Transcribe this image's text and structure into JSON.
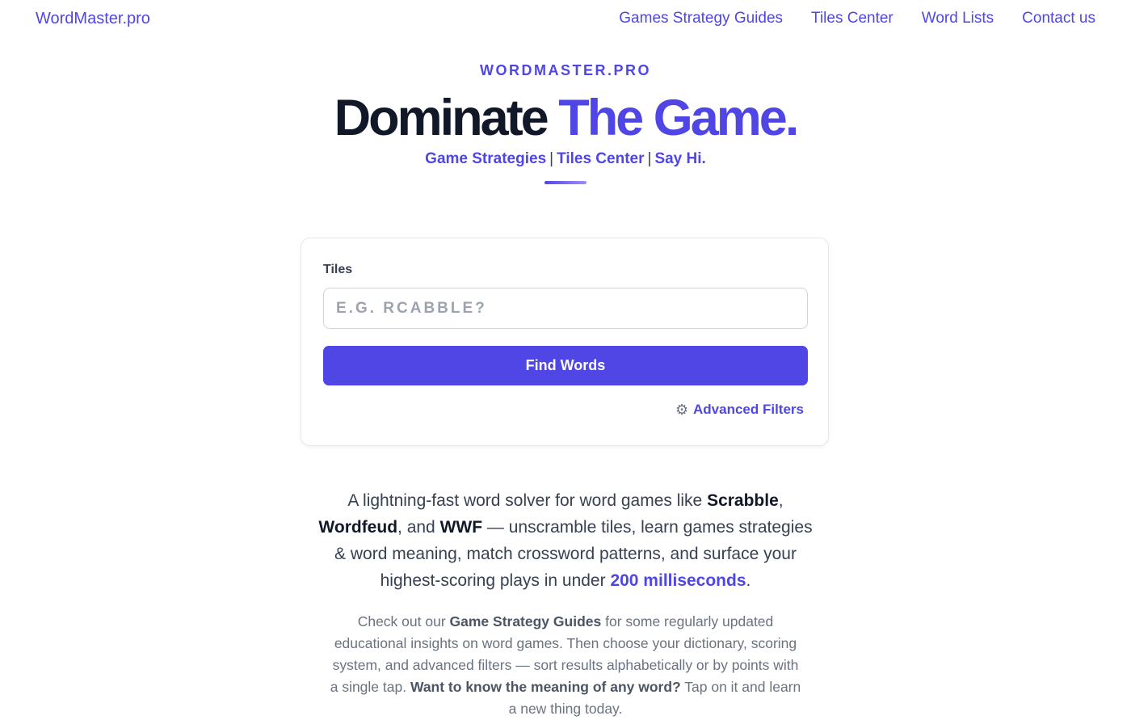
{
  "nav": {
    "brand": "WordMaster.pro",
    "links": [
      "Games Strategy Guides",
      "Tiles Center",
      "Word Lists",
      "Contact us"
    ]
  },
  "hero": {
    "eyebrow": "WORDMASTER.PRO",
    "headline_part1": "Dominate ",
    "headline_accent": "The Game.",
    "sublinks": [
      "Game Strategies",
      "Tiles Center",
      "Say Hi."
    ],
    "separator": "|"
  },
  "search": {
    "label": "Tiles",
    "placeholder": "E.G. RCABBLE?",
    "value": "",
    "button_label": "Find Words",
    "advanced_filters_label": "Advanced Filters",
    "advanced_filters_icon": "gear-icon"
  },
  "description": {
    "p1_a": "A lightning-fast word solver for word games like ",
    "p1_scrabble": "Scrabble",
    "p1_comma1": ", ",
    "p1_wordfeud": "Wordfeud",
    "p1_b": ", and ",
    "p1_wwf": "WWF",
    "p1_c": " — unscramble tiles, learn games strategies & word meaning, match crossword patterns, and surface your highest-scoring plays in under ",
    "p1_hl": "200 milliseconds",
    "p1_end": ".",
    "p2_a": "Check out our ",
    "p2_bold1": "Game Strategy Guides",
    "p2_b": " for some regularly updated educational insights on word games. Then choose your dictionary, scoring system, and advanced filters — sort results alphabetically or by points with a single tap. ",
    "p2_bold2": "Want to know the meaning of any word?",
    "p2_c": " Tap on it and learn a new thing today."
  },
  "colors": {
    "accent": "#4f46e5",
    "text_dark": "#111827",
    "text_muted": "#6b7280"
  }
}
